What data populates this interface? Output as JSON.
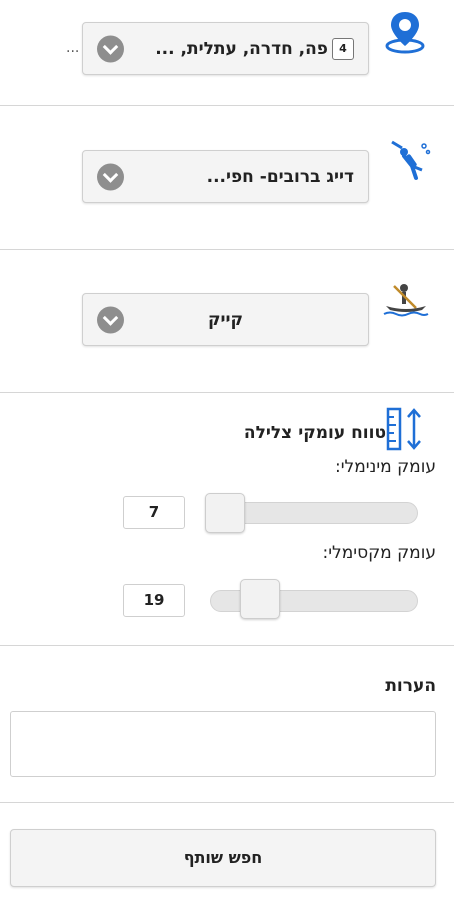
{
  "location": {
    "icon": "location-pin-icon",
    "count": "4",
    "value": "פה, חדרה, עתלית, ...",
    "overflow": "..."
  },
  "dive_type": {
    "icon": "scuba-diver-icon",
    "value": "דייג ברובים- חפי..."
  },
  "entry_type": {
    "icon": "kayak-icon",
    "value": "קייק"
  },
  "depth_range": {
    "icon": "ruler-vertical-arrows-icon",
    "title": "טווח עומקי צלילה",
    "min_label": "עומק מינימלי:",
    "min_value": "7",
    "min_fraction": 0.0,
    "max_label": "עומק מקסימלי:",
    "max_value": "19",
    "max_fraction": 0.2
  },
  "notes": {
    "label": "הערות",
    "value": ""
  },
  "search_button": {
    "label": "חפש שותף"
  },
  "colors": {
    "accent_blue": "#1f6fd6",
    "chevron_gray": "#8e8e8e",
    "field_bg": "#f4f4f4"
  }
}
